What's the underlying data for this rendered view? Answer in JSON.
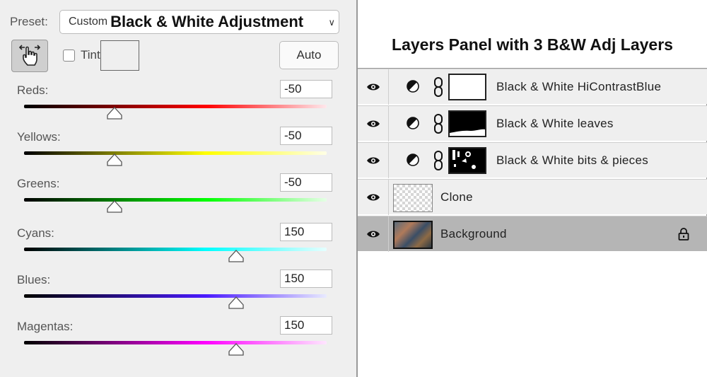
{
  "bw_panel": {
    "preset_label": "Preset:",
    "preset_custom": "Custom",
    "preset_name": "Black & White Adjustment",
    "tint_label": "Tint",
    "tint_checked": false,
    "auto_label": "Auto",
    "icons": {
      "hand": "targeted-adjustment-hand-icon",
      "chevron": "chevron-down-icon"
    },
    "sliders": [
      {
        "label": "Reds:",
        "value": "-50",
        "min": -200,
        "max": 300,
        "colors": [
          "#000000",
          "#ff0000",
          "#ffe8ec"
        ]
      },
      {
        "label": "Yellows:",
        "value": "-50",
        "min": -200,
        "max": 300,
        "colors": [
          "#000000",
          "#ffff00",
          "#ffffe6"
        ]
      },
      {
        "label": "Greens:",
        "value": "-50",
        "min": -200,
        "max": 300,
        "colors": [
          "#000000",
          "#00ff00",
          "#e6ffe6"
        ]
      },
      {
        "label": "Cyans:",
        "value": "150",
        "min": -200,
        "max": 300,
        "colors": [
          "#000000",
          "#00ffff",
          "#e6ffff"
        ]
      },
      {
        "label": "Blues:",
        "value": "150",
        "min": -200,
        "max": 300,
        "colors": [
          "#000000",
          "#4a1aff",
          "#e8eaff"
        ]
      },
      {
        "label": "Magentas:",
        "value": "150",
        "min": -200,
        "max": 300,
        "colors": [
          "#000000",
          "#ff00ff",
          "#ffe6ff"
        ]
      }
    ]
  },
  "layers_panel": {
    "title": "Layers Panel with 3 B&W Adj Layers",
    "layers": [
      {
        "name": "Black & White HiContrastBlue",
        "type": "adjustment",
        "visible": true,
        "mask": "white"
      },
      {
        "name": "Black & White leaves",
        "type": "adjustment",
        "visible": true,
        "mask": "leaves"
      },
      {
        "name": "Black & White bits & pieces",
        "type": "adjustment",
        "visible": true,
        "mask": "bits"
      },
      {
        "name": "Clone",
        "type": "pixel",
        "visible": true,
        "thumb": "transparent"
      },
      {
        "name": "Background",
        "type": "pixel",
        "visible": true,
        "thumb": "photo",
        "locked": true,
        "selected": true
      }
    ],
    "icons": {
      "eye": "eye-icon",
      "adjustment": "half-circle-adjustment-icon",
      "link": "chain-link-icon",
      "lock": "lock-icon"
    }
  }
}
